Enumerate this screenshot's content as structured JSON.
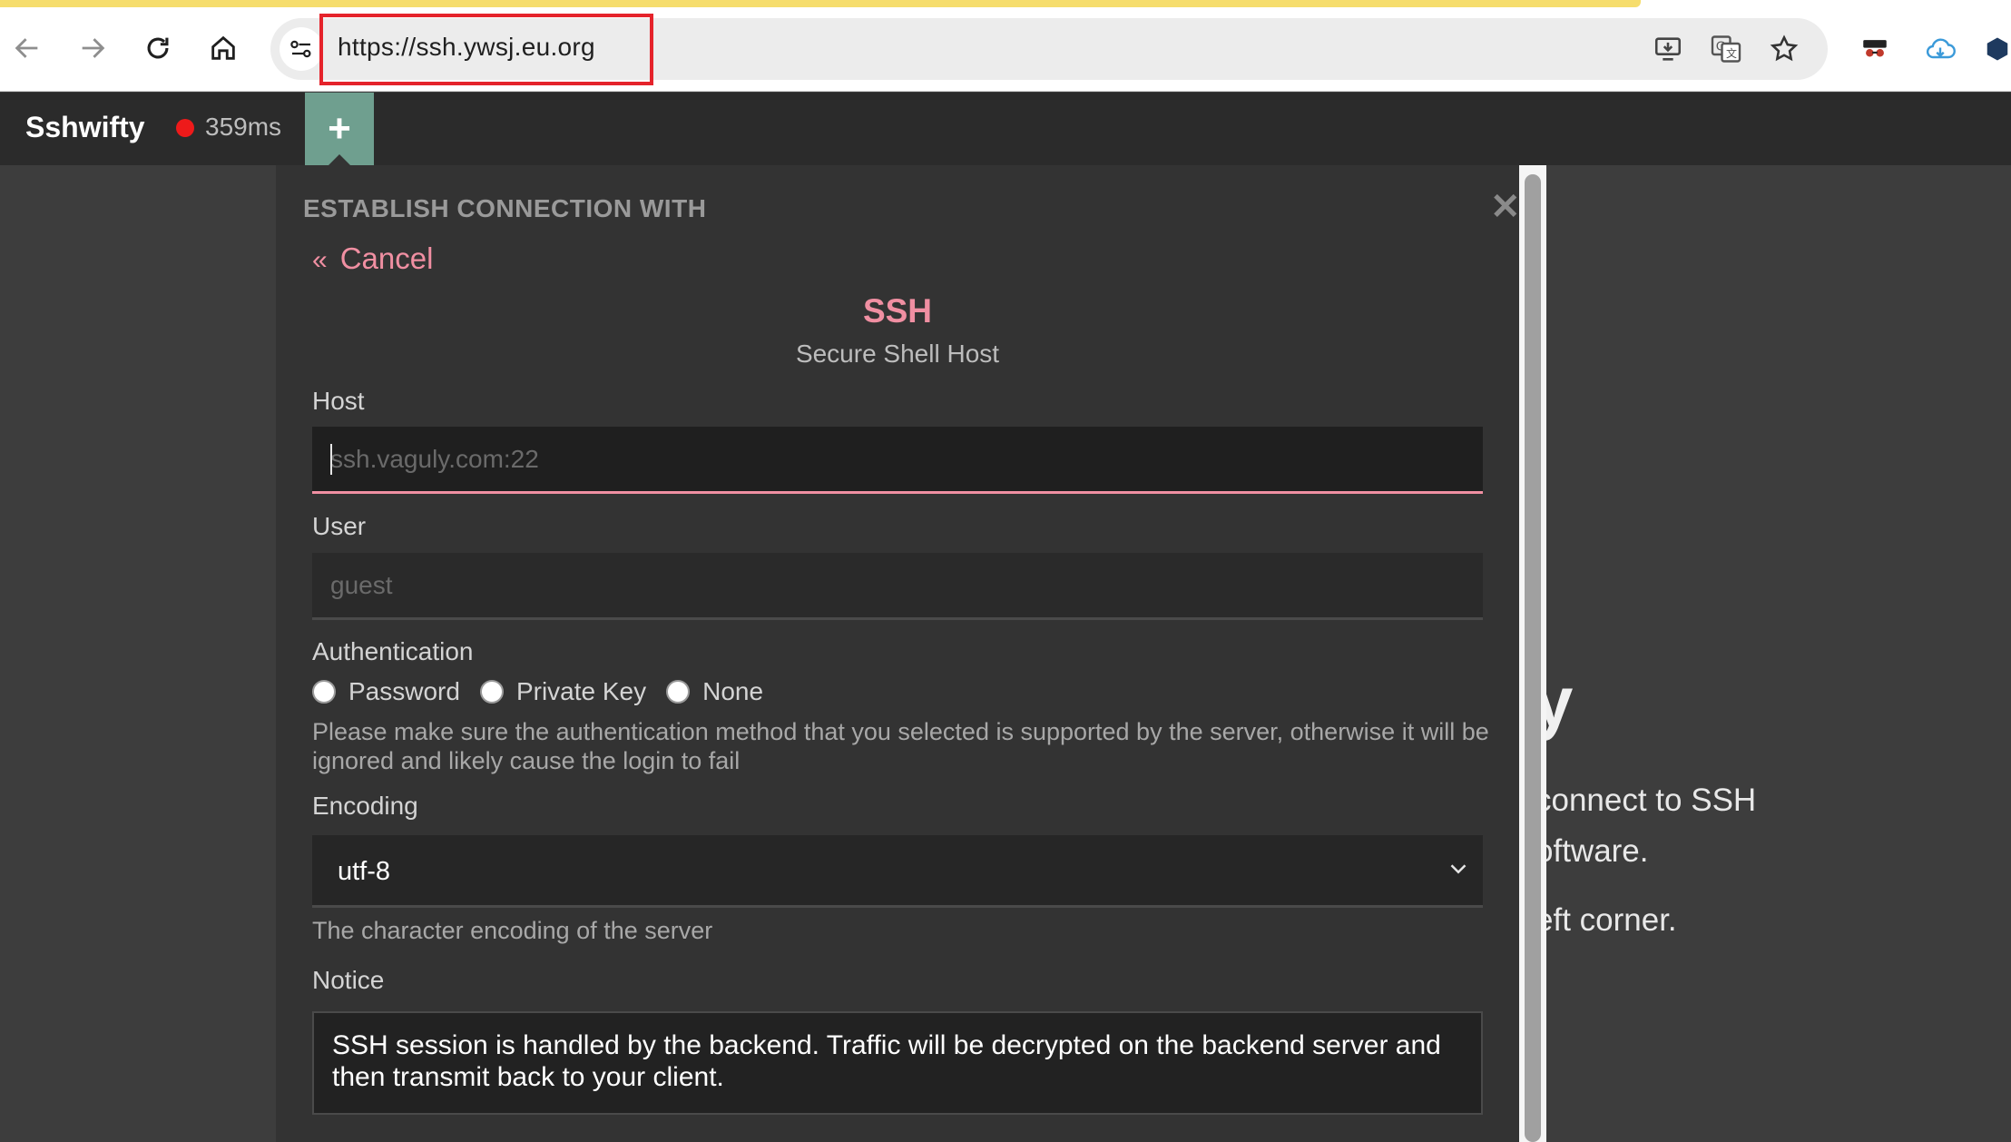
{
  "browser": {
    "url": "https://ssh.ywsj.eu.org",
    "icons": [
      "back-arrow-icon",
      "forward-arrow-icon",
      "reload-icon",
      "home-icon",
      "site-settings-icon",
      "install-app-icon",
      "translate-icon",
      "bookmark-star-icon",
      "incognito-extension-icon",
      "cloud-extension-icon",
      "extension-icon"
    ]
  },
  "appbar": {
    "brand": "Sshwifty",
    "latency": "359ms",
    "status_color": "#ee1a1a",
    "add_label": "+"
  },
  "background": {
    "heading": "y",
    "line1": "connect to SSH",
    "line2": "oftware.",
    "line3": "eft corner."
  },
  "dialog": {
    "title": "ESTABLISH CONNECTION WITH",
    "close": "✕",
    "cancel_chev": "«",
    "cancel": "Cancel",
    "method_title": "SSH",
    "method_subtitle": "Secure Shell Host",
    "host": {
      "label": "Host",
      "value": "",
      "placeholder": "ssh.vaguly.com:22"
    },
    "user": {
      "label": "User",
      "value": "",
      "placeholder": "guest"
    },
    "auth": {
      "label": "Authentication",
      "options": [
        "Password",
        "Private Key",
        "None"
      ],
      "help": "Please make sure the authentication method that you selected is supported by the server, otherwise it will be ignored and likely cause the login to fail"
    },
    "encoding": {
      "label": "Encoding",
      "value": "utf-8",
      "help": "The character encoding of the server"
    },
    "notice": {
      "label": "Notice",
      "text": "SSH session is handled by the backend. Traffic will be decrypted on the backend server and then transmit back to your client."
    }
  },
  "colors": {
    "accent": "#f08fa2",
    "tab_add": "#6f9f8f",
    "dialog_bg": "#333333",
    "url_highlight": "#e5232b"
  }
}
